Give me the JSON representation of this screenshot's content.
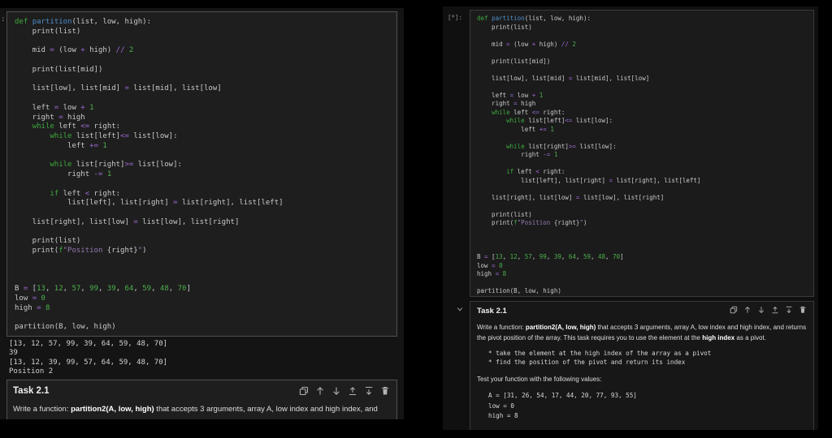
{
  "colors": {
    "background": "#000000",
    "cell_background": "#1e1e1e",
    "cell_border": "#515151",
    "keyword_green": "#3da93d",
    "function_blue": "#4e8fca",
    "number_green": "#4db04d",
    "operator_purple": "#9e6bd6",
    "string_purple": "#9678b0",
    "code_text": "#c9c9c9"
  },
  "code_lines": [
    "def partition(list, low, high):",
    "    print(list)",
    "",
    "    mid = (low + high) // 2",
    "",
    "    print(list[mid])",
    "",
    "    list[low], list[mid] = list[mid], list[low]",
    "",
    "    left = low + 1",
    "    right = high",
    "    while left <= right:",
    "        while list[left]<= list[low]:",
    "            left += 1",
    "",
    "        while list[right]>= list[low]:",
    "            right -= 1",
    "",
    "        if left < right:",
    "            list[left], list[right] = list[right], list[left]",
    "",
    "    list[right], list[low] = list[low], list[right]",
    "",
    "    print(list)",
    "    print(f\"Position {right}\")",
    "",
    "",
    "",
    "B = [13, 12, 57, 99, 39, 64, 59, 48, 70]",
    "low = 0",
    "high = 8",
    "",
    "partition(B, low, high)"
  ],
  "left_panel": {
    "execution_prompt": ":",
    "output_lines": [
      "[13, 12, 57, 99, 39, 64, 59, 48, 70]",
      "39",
      "[13, 12, 39, 99, 57, 64, 59, 48, 70]",
      "Position 2"
    ],
    "task": {
      "title": "Task 2.1",
      "paragraph": [
        {
          "t": "Write a function: "
        },
        {
          "t": "partition2(A, low, high)",
          "b": true
        },
        {
          "t": " that accepts 3 arguments, array A, low index and high index, and"
        }
      ]
    }
  },
  "right_panel": {
    "execution_prompt": "[*]:",
    "task": {
      "title": "Task 2.1",
      "paragraph1": [
        {
          "t": "Write a function: "
        },
        {
          "t": "partition2(A, low, high)",
          "b": true
        },
        {
          "t": " that accepts 3 arguments, array A, low index and high index, and returns the pivot position of the array. This task requires you to use the element at the "
        },
        {
          "t": "high index",
          "b": true
        },
        {
          "t": " as a pivot."
        }
      ],
      "bullet_lines": [
        "* take the element at the high index of the array as a pivot",
        "* find the position of the pivot and return its index"
      ],
      "paragraph2": "Test your function with the following values:",
      "code_block_lines": [
        "A = [31, 26, 54, 17, 44, 20, 77, 93, 55]",
        "low = 0",
        "high = 8"
      ]
    }
  },
  "cell_toolbar_icons": [
    "duplicate",
    "move-up",
    "move-down",
    "insert-above",
    "insert-below",
    "delete"
  ]
}
